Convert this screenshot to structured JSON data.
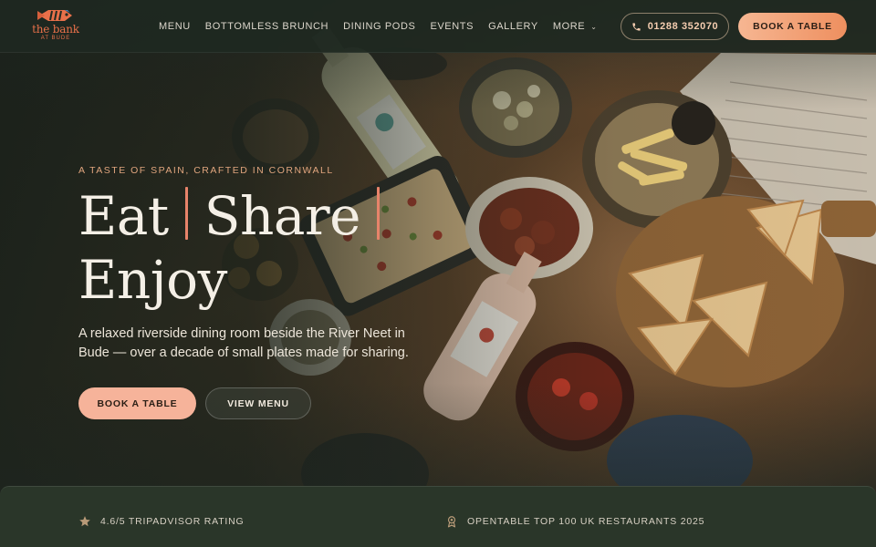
{
  "brand": {
    "name": "the bank",
    "sub": "AT BUDE"
  },
  "nav": {
    "items": [
      {
        "label": "MENU"
      },
      {
        "label": "BOTTOMLESS BRUNCH"
      },
      {
        "label": "DINING PODS"
      },
      {
        "label": "EVENTS"
      },
      {
        "label": "GALLERY"
      },
      {
        "label": "MORE"
      }
    ],
    "phone": "01288 352070",
    "book": "BOOK A TABLE"
  },
  "hero": {
    "eyebrow": "A TASTE OF SPAIN, CRAFTED IN CORNWALL",
    "headline": {
      "word1": "Eat",
      "word2": "Share",
      "word3": "Enjoy"
    },
    "lede": "A relaxed riverside dining room beside the River Neet in Bude — over a decade of small plates made for sharing.",
    "cta_primary": "BOOK A TABLE",
    "cta_secondary": "VIEW MENU"
  },
  "badges": [
    {
      "icon": "star-icon",
      "label": "4.6/5 TRIPADVISOR RATING"
    },
    {
      "icon": "award-icon",
      "label": "OPENTABLE TOP 100 UK RESTAURANTS 2025"
    }
  ],
  "colors": {
    "accent": "#f6b39a",
    "accent_dark": "#ee8f5f",
    "background": "#1f2a22",
    "eyebrow": "#e0a57e",
    "headline_bar": "#e8836a"
  }
}
